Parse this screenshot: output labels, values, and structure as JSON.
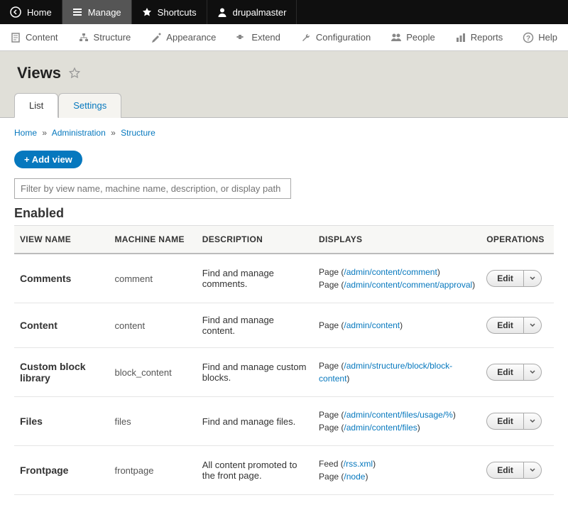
{
  "toolbar": {
    "home": "Home",
    "manage": "Manage",
    "shortcuts": "Shortcuts",
    "user": "drupalmaster"
  },
  "admin_menu": {
    "content": "Content",
    "structure": "Structure",
    "appearance": "Appearance",
    "extend": "Extend",
    "configuration": "Configuration",
    "people": "People",
    "reports": "Reports",
    "help": "Help"
  },
  "page": {
    "title": "Views"
  },
  "tabs": {
    "list": "List",
    "settings": "Settings"
  },
  "breadcrumb": {
    "home": "Home",
    "admin": "Administration",
    "structure": "Structure"
  },
  "actions": {
    "add_view": "+ Add view"
  },
  "filter": {
    "placeholder": "Filter by view name, machine name, description, or display path"
  },
  "section": {
    "enabled": "Enabled"
  },
  "columns": {
    "view_name": "VIEW NAME",
    "machine_name": "MACHINE NAME",
    "description": "DESCRIPTION",
    "displays": "DISPLAYS",
    "operations": "OPERATIONS"
  },
  "ops": {
    "edit": "Edit"
  },
  "rows": [
    {
      "name": "Comments",
      "machine": "comment",
      "desc": "Find and manage comments.",
      "displays": [
        {
          "prefix": "Page (",
          "link": "/admin/content/comment",
          "suffix": ")"
        },
        {
          "prefix": "Page (",
          "link": "/admin/content/comment/approval",
          "suffix": ")"
        }
      ]
    },
    {
      "name": "Content",
      "machine": "content",
      "desc": "Find and manage content.",
      "displays": [
        {
          "prefix": "Page (",
          "link": "/admin/content",
          "suffix": ")"
        }
      ]
    },
    {
      "name": "Custom block library",
      "machine": "block_content",
      "desc": "Find and manage custom blocks.",
      "displays": [
        {
          "prefix": "Page (",
          "link": "/admin/structure/block/block-content",
          "suffix": ")"
        }
      ]
    },
    {
      "name": "Files",
      "machine": "files",
      "desc": "Find and manage files.",
      "displays": [
        {
          "prefix": "Page (",
          "link": "/admin/content/files/usage/%",
          "suffix": ")"
        },
        {
          "prefix": "Page (",
          "link": "/admin/content/files",
          "suffix": ")"
        }
      ]
    },
    {
      "name": "Frontpage",
      "machine": "frontpage",
      "desc": "All content promoted to the front page.",
      "displays": [
        {
          "prefix": "Feed (",
          "link": "/rss.xml",
          "suffix": ")"
        },
        {
          "prefix": "Page (",
          "link": "/node",
          "suffix": ")"
        }
      ]
    }
  ]
}
